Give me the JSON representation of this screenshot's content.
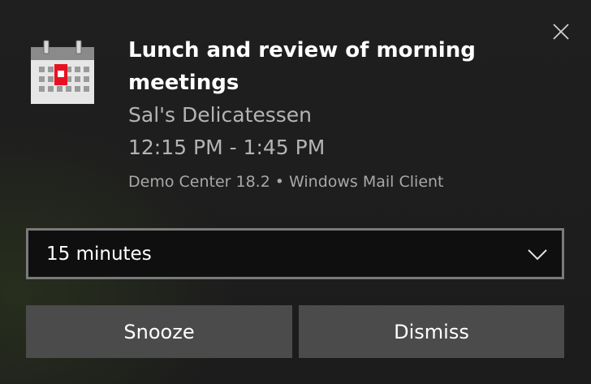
{
  "notification": {
    "title": "Lunch and review of morning meetings",
    "location": "Sal's Delicatessen",
    "time": "12:15 PM - 1:45 PM",
    "attribution": {
      "source": "Demo Center 18.2",
      "separator": "•",
      "app": "Windows Mail Client"
    },
    "icon": "calendar-icon",
    "close_icon": "close-icon"
  },
  "snooze_select": {
    "selected": "15 minutes",
    "chevron_icon": "chevron-down-icon"
  },
  "actions": {
    "snooze_label": "Snooze",
    "dismiss_label": "Dismiss"
  },
  "colors": {
    "background": "#1c1c1c",
    "button": "#4b4b4b",
    "select_border": "#7a7a7a",
    "calendar_accent": "#e81123"
  }
}
